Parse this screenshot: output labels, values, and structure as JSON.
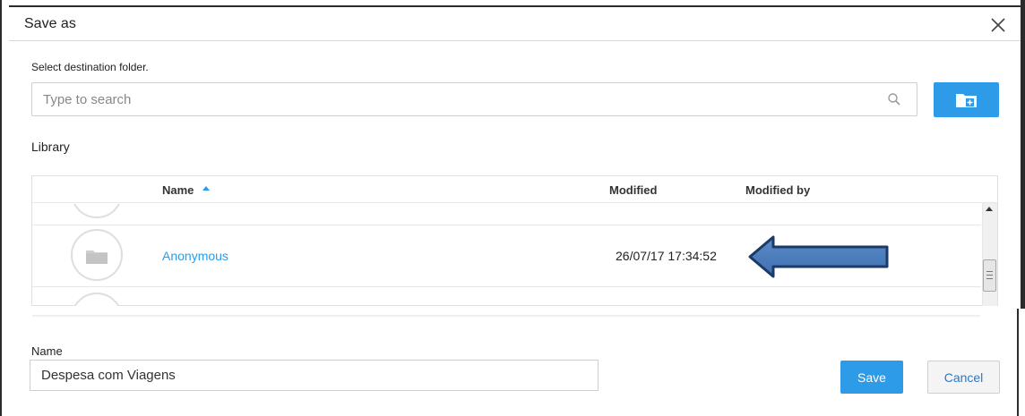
{
  "dialog": {
    "title": "Save as",
    "close_icon": "close-icon"
  },
  "destination": {
    "label": "Select destination folder.",
    "search_placeholder": "Type to search",
    "search_icon": "search-icon",
    "new_folder_icon": "new-folder-icon"
  },
  "library": {
    "label": "Library",
    "columns": {
      "name": "Name",
      "modified": "Modified",
      "modified_by": "Modified by"
    },
    "sort": {
      "column": "Name",
      "direction": "ascending"
    },
    "rows": [
      {
        "name": "Anonymous",
        "modified": "26/07/17 17:34:52",
        "modified_by": "",
        "icon": "folder-icon"
      }
    ]
  },
  "name_field": {
    "label": "Name",
    "value": "Despesa com Viagens"
  },
  "buttons": {
    "save": "Save",
    "cancel": "Cancel"
  },
  "colors": {
    "accent": "#2d9be8",
    "annotation_arrow": "#4f80bd"
  }
}
